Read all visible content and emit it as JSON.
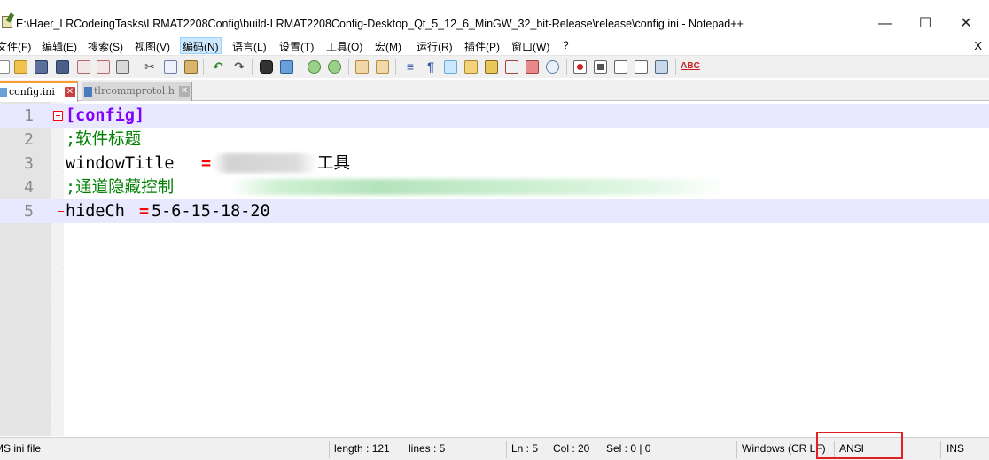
{
  "window": {
    "title": "E:\\Haer_LRCodeingTasks\\LRMAT2208Config\\build-LRMAT2208Config-Desktop_Qt_5_12_6_MinGW_32_bit-Release\\release\\config.ini - Notepad++",
    "minimize_glyph": "—",
    "maximize_glyph": "☐",
    "close_glyph": "✕"
  },
  "menu": {
    "items": [
      {
        "label": "文件(F)"
      },
      {
        "label": "编辑(E)"
      },
      {
        "label": "搜索(S)"
      },
      {
        "label": "视图(V)"
      },
      {
        "label": "编码(N)"
      },
      {
        "label": "语言(L)"
      },
      {
        "label": "设置(T)"
      },
      {
        "label": "工具(O)"
      },
      {
        "label": "宏(M)"
      },
      {
        "label": "运行(R)"
      },
      {
        "label": "插件(P)"
      },
      {
        "label": "窗口(W)"
      },
      {
        "label": "?"
      }
    ],
    "close_doc": "X"
  },
  "toolbar": {
    "icons": [
      "new-file-icon",
      "open-file-icon",
      "save-icon",
      "save-all-icon",
      "close-icon",
      "close-all-icon",
      "print-icon",
      "cut-icon",
      "copy-icon",
      "paste-icon",
      "undo-icon",
      "redo-icon",
      "find-icon",
      "replace-icon",
      "zoom-in-icon",
      "zoom-out-icon",
      "sync-vertical-icon",
      "sync-horizontal-icon",
      "word-wrap-icon",
      "show-all-chars-icon",
      "indent-guide-icon",
      "udl-icon",
      "doc-map-icon",
      "function-list-icon",
      "folder-workspace-icon",
      "monitoring-icon",
      "record-macro-icon",
      "stop-macro-icon",
      "play-macro-icon",
      "run-macro-multiple-icon",
      "save-macro-icon",
      "spell-check-icon"
    ],
    "spell_label": "ABC"
  },
  "tabs": [
    {
      "label": "config.ini",
      "active": true,
      "close": "✕"
    },
    {
      "label": "tlrcommprotol.h",
      "active": false,
      "close": "✕"
    }
  ],
  "editor": {
    "line_numbers": [
      "1",
      "2",
      "3",
      "4",
      "5"
    ],
    "lines": {
      "l1_section": "[config]",
      "l2_comment": ";软件标题",
      "l3_key": "windowTitle",
      "l3_op": "=",
      "l3_value_visible": "工具",
      "l4_comment": ";通道隐藏控制",
      "l5_key": "hideCh",
      "l5_op": "=",
      "l5_value": "5-6-15-18-20"
    }
  },
  "status": {
    "filetype": "MS ini file",
    "length": "length : 121",
    "lines": "lines : 5",
    "ln": "Ln : 5",
    "col": "Col : 20",
    "sel": "Sel : 0 | 0",
    "eol": "Windows (CR LF)",
    "encoding": "ANSI",
    "ins": "INS"
  },
  "colors": {
    "section": "#8000ff",
    "comment": "#008000",
    "operator": "#ff0000",
    "highlight_box": "#e02020",
    "current_line": "#e8e8ff"
  }
}
